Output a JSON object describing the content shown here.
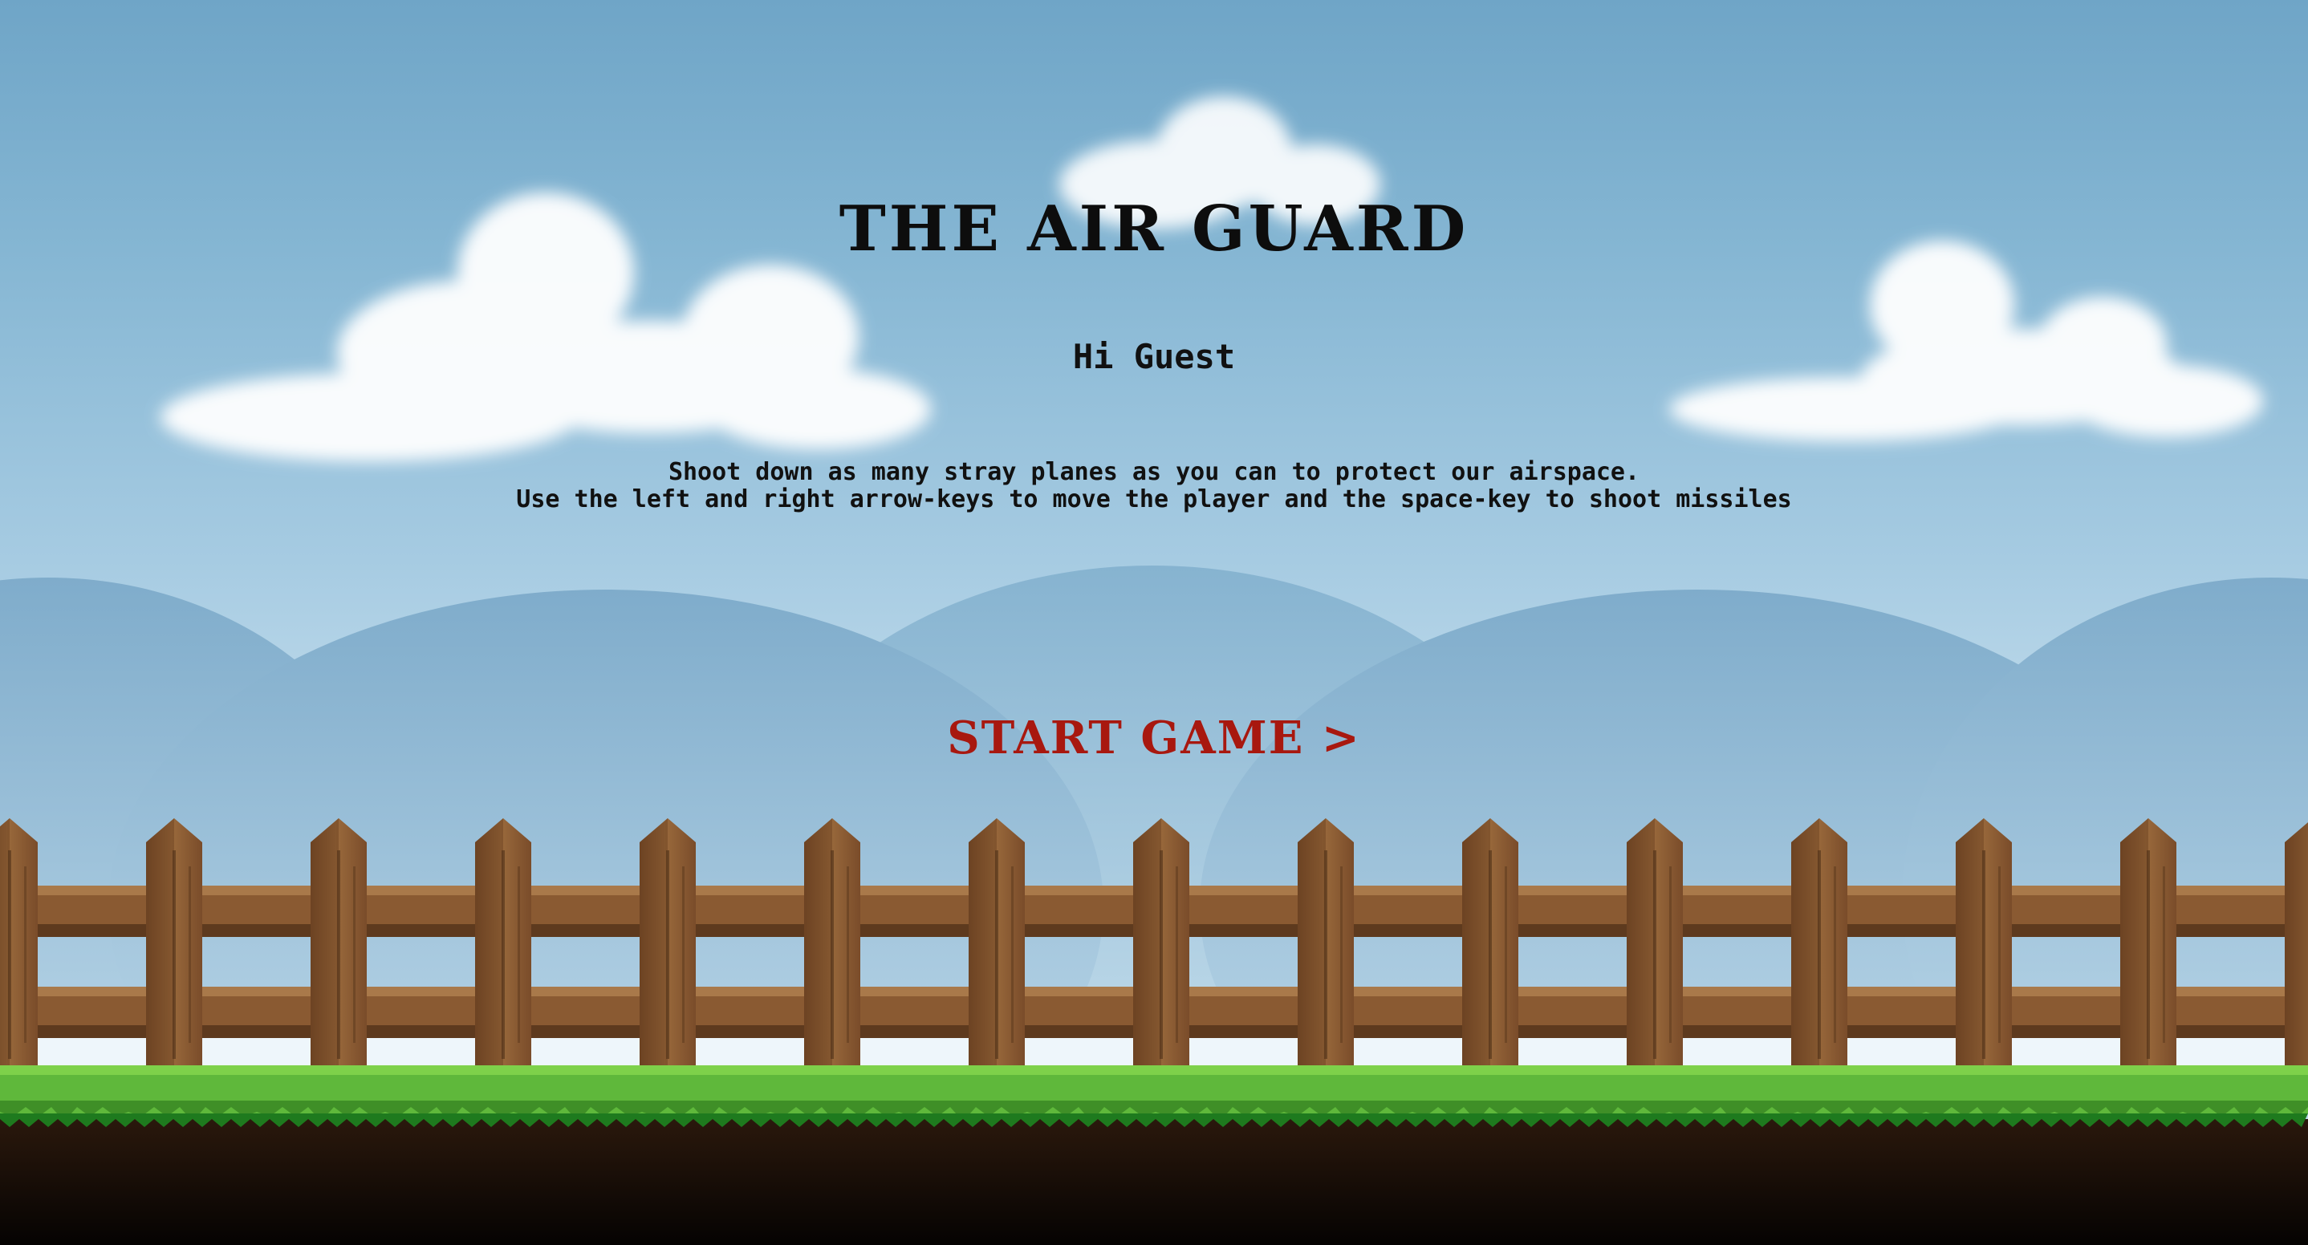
{
  "game": {
    "title": "THE AIR GUARD",
    "greeting": "Hi Guest",
    "instructions": [
      "Shoot down as many stray planes as you can to protect our airspace.",
      "Use the left and right arrow-keys to move the player and the space-key to shoot missiles"
    ],
    "start_label": "START GAME >"
  },
  "colors": {
    "sky_top": "#6fa5c7",
    "sky_bottom": "#f3f9fc",
    "title_text": "#0d0d0d",
    "start_text": "#a8180f",
    "fence_wood": "#8a5a32",
    "grass": "#5fb83b",
    "soil": "#1a0f08"
  },
  "icons": [
    "cloud-icon",
    "hill-icon",
    "fence-icon",
    "grass-icon"
  ]
}
